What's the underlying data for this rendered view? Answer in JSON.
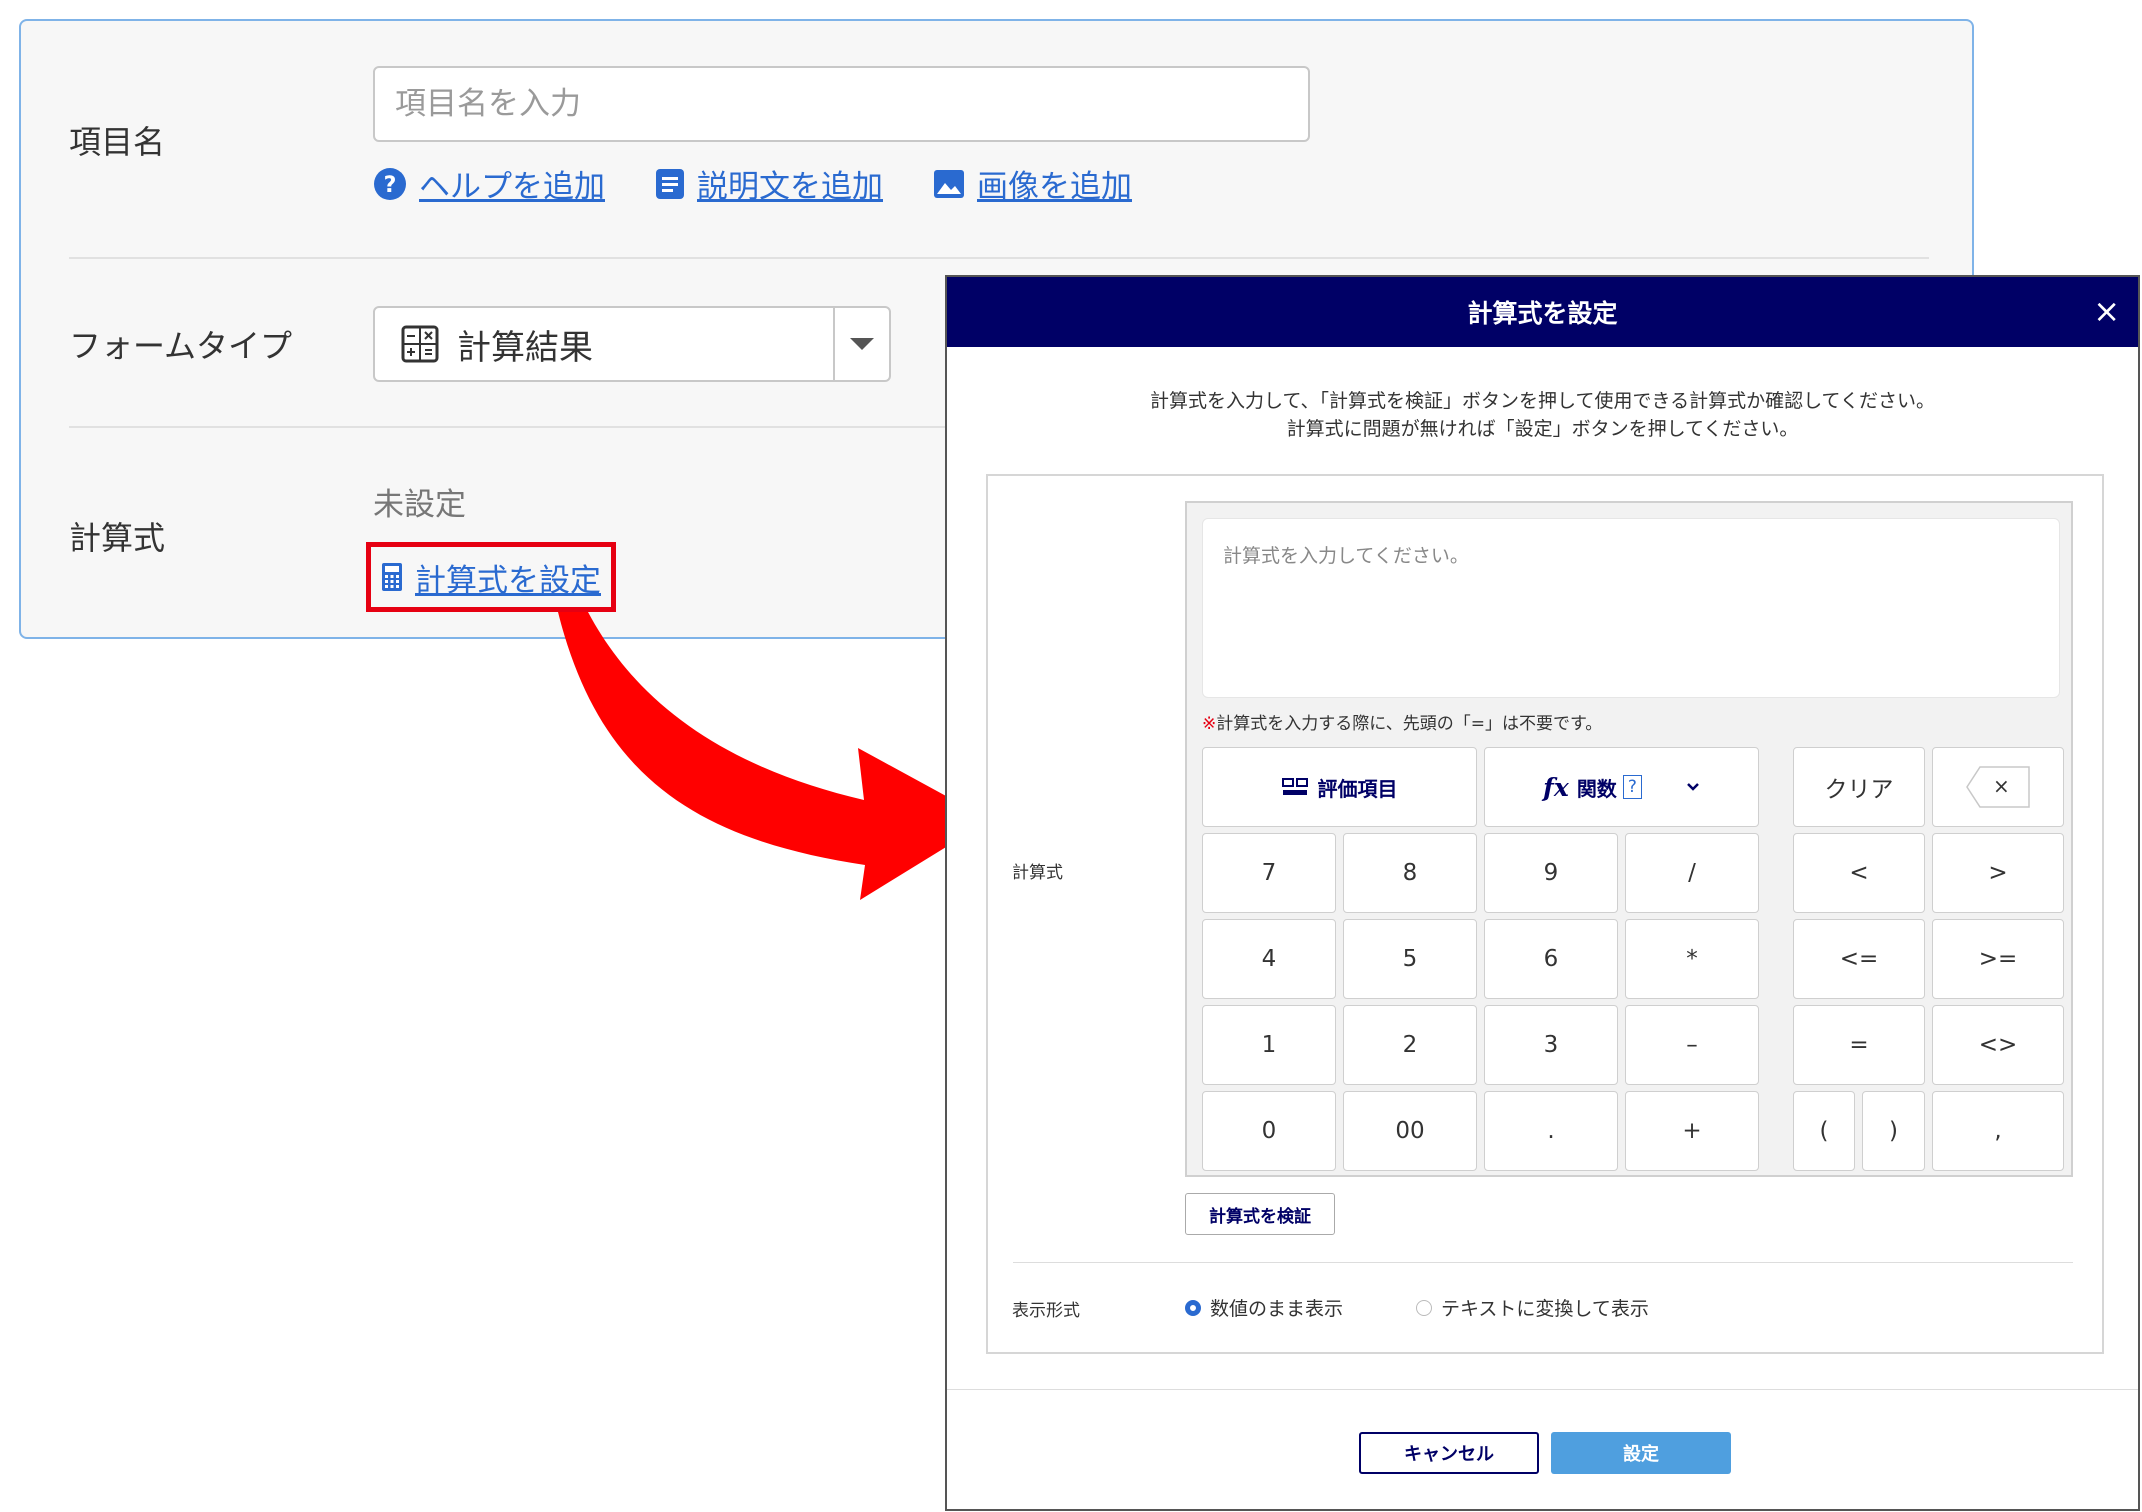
{
  "form": {
    "item_name_label": "項目名",
    "item_name_placeholder": "項目名を入力",
    "add_help": "ヘルプを追加",
    "add_description": "説明文を追加",
    "add_image": "画像を追加",
    "form_type_label": "フォームタイプ",
    "form_type_value": "計算結果",
    "formula_label": "計算式",
    "formula_status": "未設定",
    "set_formula_link": "計算式を設定"
  },
  "modal": {
    "title": "計算式を設定",
    "close": "×",
    "instruction_line1": "計算式を入力して、「計算式を検証」ボタンを押して使用できる計算式か確認してください。",
    "instruction_line2": "計算式に問題が無ければ「設定」ボタンを押してください。",
    "formula_label": "計算式",
    "formula_placeholder": "計算式を入力してください。",
    "note_mark": "※",
    "note_text": "計算式を入力する際に、先頭の「=」は不要です。",
    "keys": {
      "eval_item": "評価項目",
      "function": "関数",
      "function_help": "?",
      "clear": "クリア",
      "backspace": "×",
      "k7": "7",
      "k8": "8",
      "k9": "9",
      "div": "/",
      "lt": "<",
      "gt": ">",
      "k4": "4",
      "k5": "5",
      "k6": "6",
      "mul": "*",
      "le": "<=",
      "ge": ">=",
      "k1": "1",
      "k2": "2",
      "k3": "3",
      "minus": "–",
      "eq": "=",
      "ne": "<>",
      "k0": "0",
      "k00": "00",
      "dot": ".",
      "plus": "+",
      "lparen": "(",
      "rparen": ")",
      "comma": ","
    },
    "verify_button": "計算式を検証",
    "display_label": "表示形式",
    "display_option1": "数値のまま表示",
    "display_option2": "テキストに変換して表示",
    "display_selected": "数値のまま表示",
    "cancel_button": "キャンセル",
    "set_button": "設定"
  },
  "colors": {
    "header_navy": "#000066",
    "link_blue": "#2a6ad0",
    "highlight_red": "#e60012",
    "set_button_blue": "#4f9fdf"
  },
  "icons": [
    "help-circle-icon",
    "document-icon",
    "image-icon",
    "calculator-grid-icon",
    "calculator-icon",
    "fields-icon",
    "function-icon",
    "chevron-down-icon",
    "backspace-icon",
    "close-icon",
    "red-arrow"
  ]
}
